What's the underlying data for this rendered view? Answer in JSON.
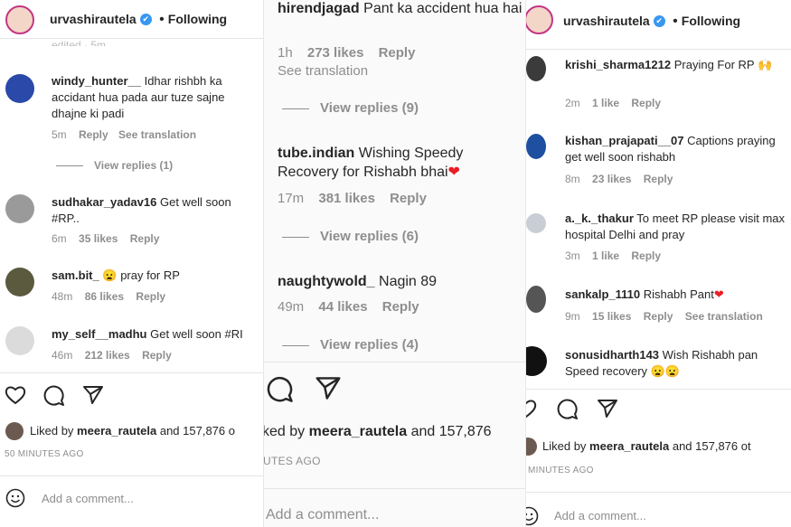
{
  "panel1": {
    "header": {
      "username": "urvashirautela",
      "verified_mark": "✔",
      "following": "Following"
    },
    "cut_text": "edited · 5m",
    "comments": [
      {
        "user": "windy_hunter__",
        "text": "Idhar rishbh ka accidant hua pada aur tuze sajne dhajne ki padi",
        "time": "5m",
        "reply": "Reply",
        "translation": "See translation",
        "view_replies": "View replies (1)"
      },
      {
        "user": "sudhakar_yadav16",
        "text": "Get well soon #RP..",
        "time": "6m",
        "likes": "35 likes",
        "reply": "Reply"
      },
      {
        "user": "sam.bit_",
        "emoji": "😦",
        "text": "pray for RP",
        "time": "48m",
        "likes": "86 likes",
        "reply": "Reply"
      },
      {
        "user": "my_self__madhu",
        "text": "Get well soon #RI",
        "time": "46m",
        "likes": "212 likes",
        "reply": "Reply"
      }
    ],
    "liked_by_prefix": "Liked by",
    "liked_by_user": "meera_rautela",
    "liked_by_rest": "and 157,876 o",
    "time_ago": "50 MINUTES AGO",
    "add_comment": "Add a comment..."
  },
  "panel2": {
    "comments": [
      {
        "user": "hirendjagad",
        "text": "Pant ka accident hua hai",
        "time": "1h",
        "likes": "273 likes",
        "reply": "Reply",
        "translation": "See translation",
        "view_replies": "View replies (9)"
      },
      {
        "user": "tube.indian",
        "text": "Wishing Speedy Recovery for Rishabh bhai",
        "heart": "❤",
        "time": "17m",
        "likes": "381 likes",
        "reply": "Reply",
        "view_replies": "View replies (6)"
      },
      {
        "user": "naughtywold_",
        "text": "Nagin 89",
        "time": "49m",
        "likes": "44 likes",
        "reply": "Reply",
        "view_replies": "View replies (4)"
      }
    ],
    "liked_text_prefix": "ked by",
    "liked_by_user": "meera_rautela",
    "liked_by_rest": "and 157,876",
    "time_ago": "UTES AGO",
    "add_comment": "Add a comment..."
  },
  "panel3": {
    "header": {
      "username": "urvashirautela",
      "verified_mark": "✔",
      "following": "Following"
    },
    "comments": [
      {
        "user": "krishi_sharma1212",
        "text": "Praying For RP",
        "emoji": "🙌",
        "time": "2m",
        "likes": "1 like",
        "reply": "Reply"
      },
      {
        "user": "kishan_prajapati__07",
        "text": "Captions praying get well soon rishabh",
        "time": "8m",
        "likes": "23 likes",
        "reply": "Reply"
      },
      {
        "user": "a._k._thakur",
        "text": "To meet RP please visit max hospital Delhi and pray",
        "time": "3m",
        "likes": "1 like",
        "reply": "Reply"
      },
      {
        "user": "sankalp_1110",
        "text": "Rishabh Pant",
        "heart": "❤",
        "time": "9m",
        "likes": "15 likes",
        "reply": "Reply",
        "translation": "See translation"
      },
      {
        "user": "sonusidharth143",
        "text": "Wish Rishabh pan Speed recovery",
        "emoji": "😦😦"
      }
    ],
    "liked_by_prefix": "Liked by",
    "liked_by_user": "meera_rautela",
    "liked_by_rest": "and 157,876 ot",
    "time_ago": "MINUTES AGO",
    "add_comment": "Add a comment..."
  }
}
